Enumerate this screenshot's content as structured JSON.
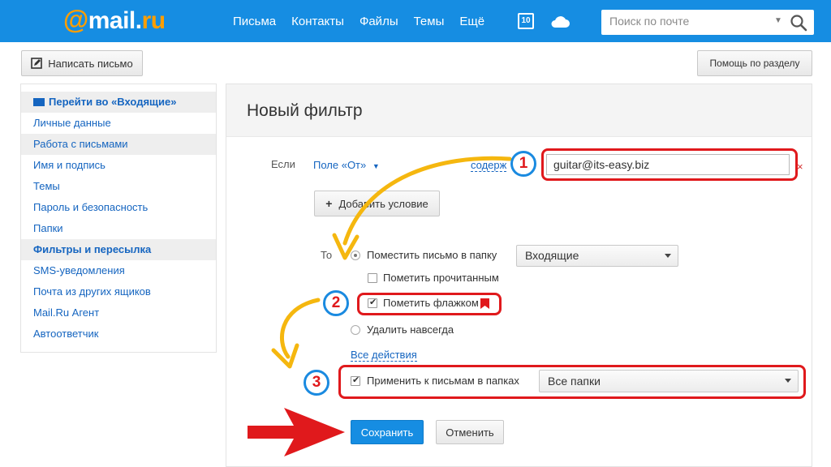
{
  "header": {
    "logo_at": "@",
    "logo_mail": "mail",
    "logo_dot": ".",
    "logo_ru": "ru",
    "nav": [
      "Письма",
      "Контакты",
      "Файлы",
      "Темы",
      "Ещё"
    ],
    "calendar_day": "10",
    "search_placeholder": "Поиск по почте"
  },
  "toolbar": {
    "write_label": "Написать письмо",
    "help_label": "Помощь по разделу"
  },
  "sidebar": {
    "items": [
      "Перейти во «Входящие»",
      "Личные данные",
      "Работа с письмами",
      "Имя и подпись",
      "Темы",
      "Пароль и безопасность",
      "Папки",
      "Фильтры и пересылка",
      "SMS-уведомления",
      "Почта из других ящиков",
      "Mail.Ru Агент",
      "Автоответчик"
    ]
  },
  "filter": {
    "title": "Новый фильтр",
    "if_label": "Если",
    "field_select": "Поле «От»",
    "contains_link": "содерж",
    "value": "guitar@its-easy.biz",
    "remove_mark": "×",
    "add_condition": "Добавить условие",
    "then_label": "То",
    "move_to_folder": "Поместить письмо в папку",
    "folder_value": "Входящие",
    "mark_read": "Пометить прочитанным",
    "mark_flag": "Пометить флажком",
    "delete_forever": "Удалить навсегда",
    "all_actions": "Все действия",
    "apply_to_folders": "Применить к письмам в папках",
    "folders_value": "Все папки",
    "save": "Сохранить",
    "cancel": "Отменить"
  },
  "annotations": {
    "badges": [
      "1",
      "2",
      "3"
    ]
  },
  "colors": {
    "header_bg": "#168de2",
    "accent_orange": "#ff9e00",
    "link_blue": "#1565c0",
    "annotation_red": "#e0191c",
    "annotation_blue": "#1a8ae0",
    "arrow_yellow": "#f5b70f"
  }
}
